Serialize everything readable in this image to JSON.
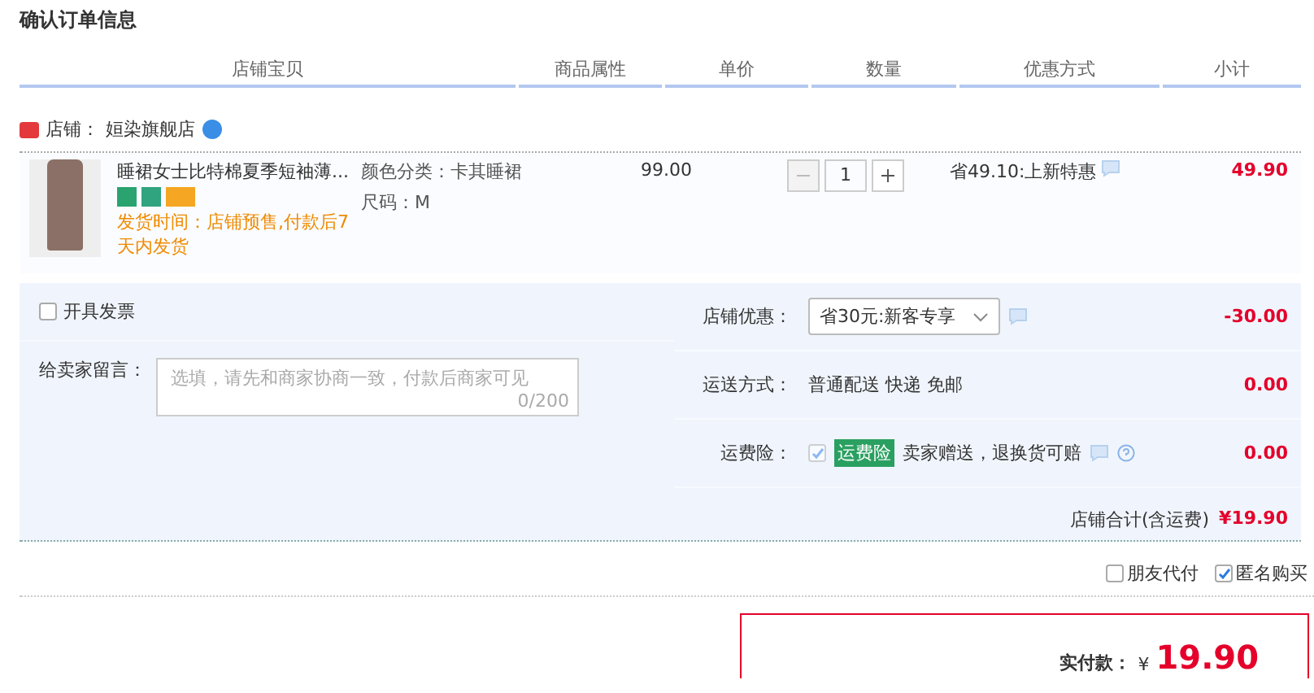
{
  "title": "确认订单信息",
  "columns": [
    "店铺宝贝",
    "商品属性",
    "单价",
    "数量",
    "优惠方式",
    "小计"
  ],
  "shop": {
    "label": "店铺：",
    "name": "姮染旗舰店"
  },
  "item": {
    "name": "睡裙女士比特棉夏季短袖薄...",
    "attributes": [
      "颜色分类：卡其睡裙",
      "尺码：M"
    ],
    "shipping_note": "发货时间：店铺预售,付款后7天内发货",
    "price": "99.00",
    "quantity": "1",
    "promotion": "省49.10:上新特惠",
    "subtotal": "49.90"
  },
  "invoice": {
    "label": "开具发票",
    "checked": false
  },
  "message": {
    "label": "给卖家留言：",
    "placeholder": "选填，请先和商家协商一致，付款后商家可见",
    "counter": "0/200"
  },
  "options": [
    {
      "kind": "select",
      "label": "店铺优惠：",
      "value": "省30元:新客专享",
      "amount": "-30.00"
    },
    {
      "kind": "text",
      "label": "运送方式：",
      "value": "普通配送 快递 免邮",
      "amount": "0.00"
    },
    {
      "kind": "insurance",
      "label": "运费险：",
      "badge": "运费险",
      "checked": true,
      "value": "卖家赠送，退换货可赔",
      "amount": "0.00"
    }
  ],
  "shop_total": {
    "label": "店铺合计(含运费)",
    "value": "¥19.90"
  },
  "extras": [
    {
      "label": "朋友代付",
      "checked": false
    },
    {
      "label": "匿名购买",
      "checked": true
    }
  ],
  "payment": {
    "label": "实付款：",
    "currency": "¥",
    "value": "19.90"
  }
}
